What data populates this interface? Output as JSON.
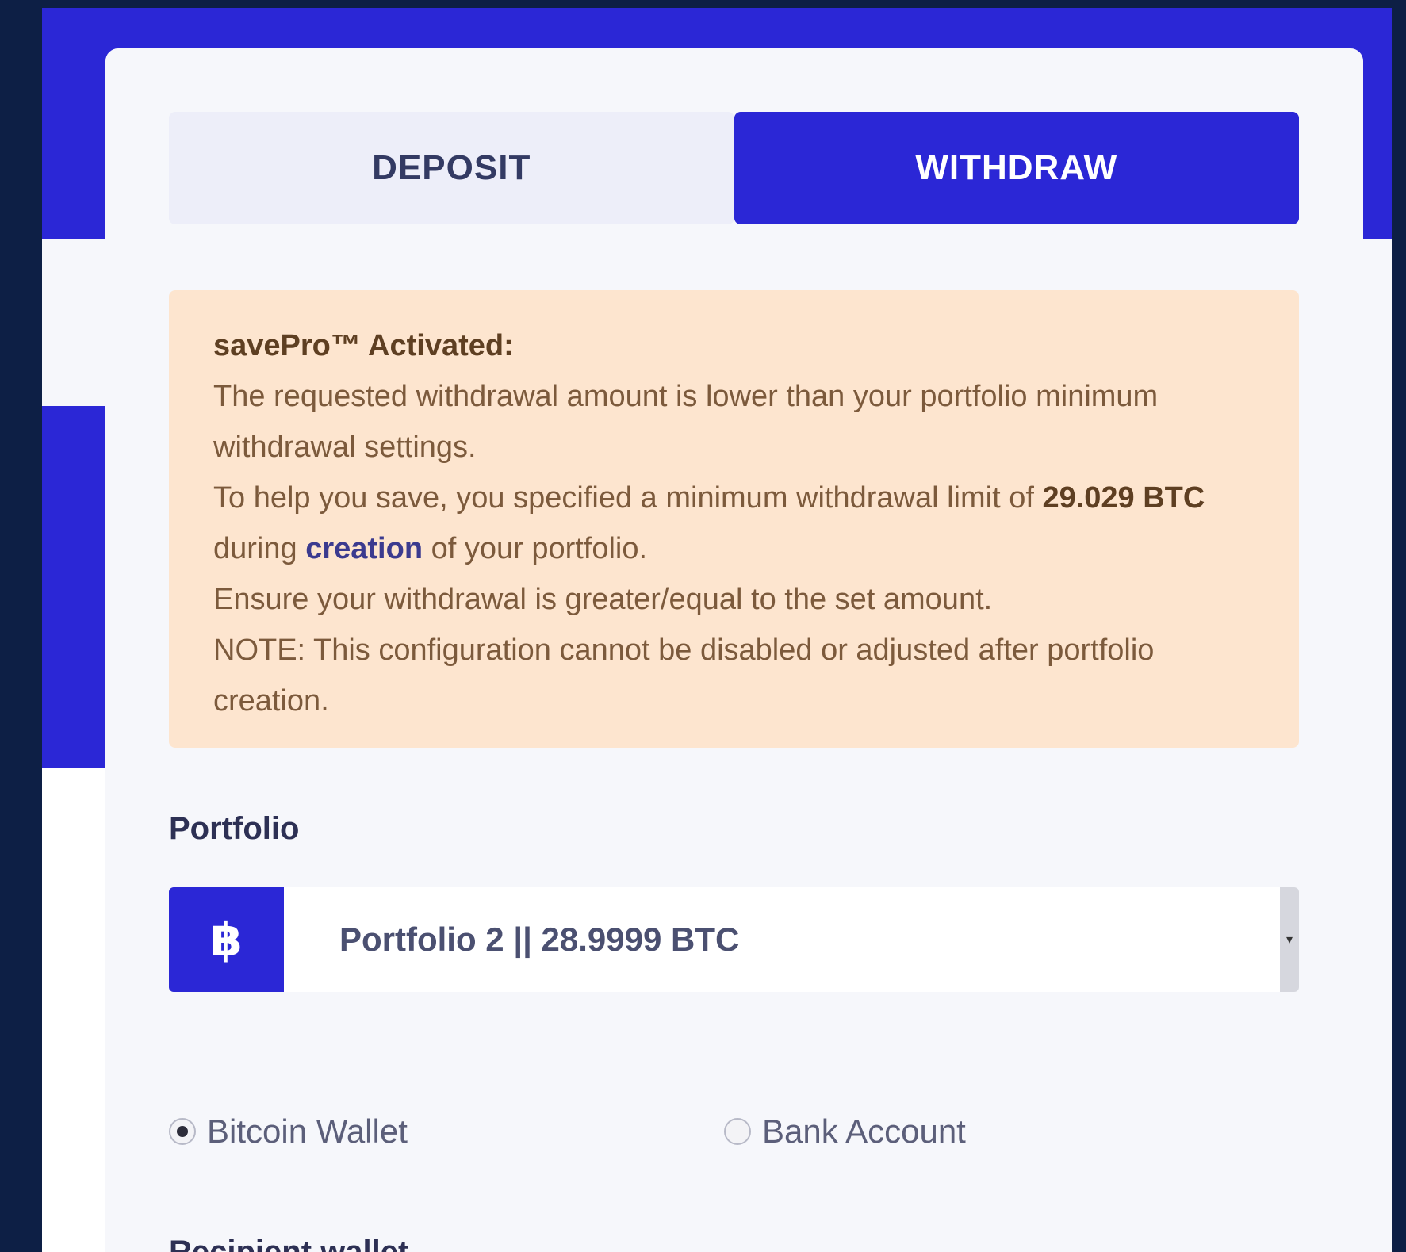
{
  "tabs": {
    "deposit": "DEPOSIT",
    "withdraw": "WITHDRAW",
    "active": "WITHDRAW"
  },
  "notice": {
    "title": "savePro™ Activated:",
    "line1": "The requested withdrawal amount is lower than your portfolio minimum withdrawal settings.",
    "line2_prefix": "To help you save, you specified a minimum withdrawal limit of",
    "amount": "29.029 BTC",
    "during": "during",
    "link": "creation",
    "line2_suffix": "of your portfolio.",
    "line3": "Ensure your withdrawal is greater/equal to the set amount.",
    "line4": "NOTE: This configuration cannot be disabled or adjusted after portfolio creation."
  },
  "portfolio": {
    "label": "Portfolio",
    "icon_glyph": "฿",
    "icon": "bitcoin-icon",
    "selected": "Portfolio 2 || 28.9999 BTC"
  },
  "destination": {
    "options": [
      "Bitcoin Wallet",
      "Bank Account"
    ],
    "selected": "Bitcoin Wallet"
  },
  "recipient": {
    "label": "Recipient wallet"
  },
  "colors": {
    "accent": "#2b27d6",
    "notice_bg": "#fde5cf",
    "page_bg": "#0d1f45"
  }
}
